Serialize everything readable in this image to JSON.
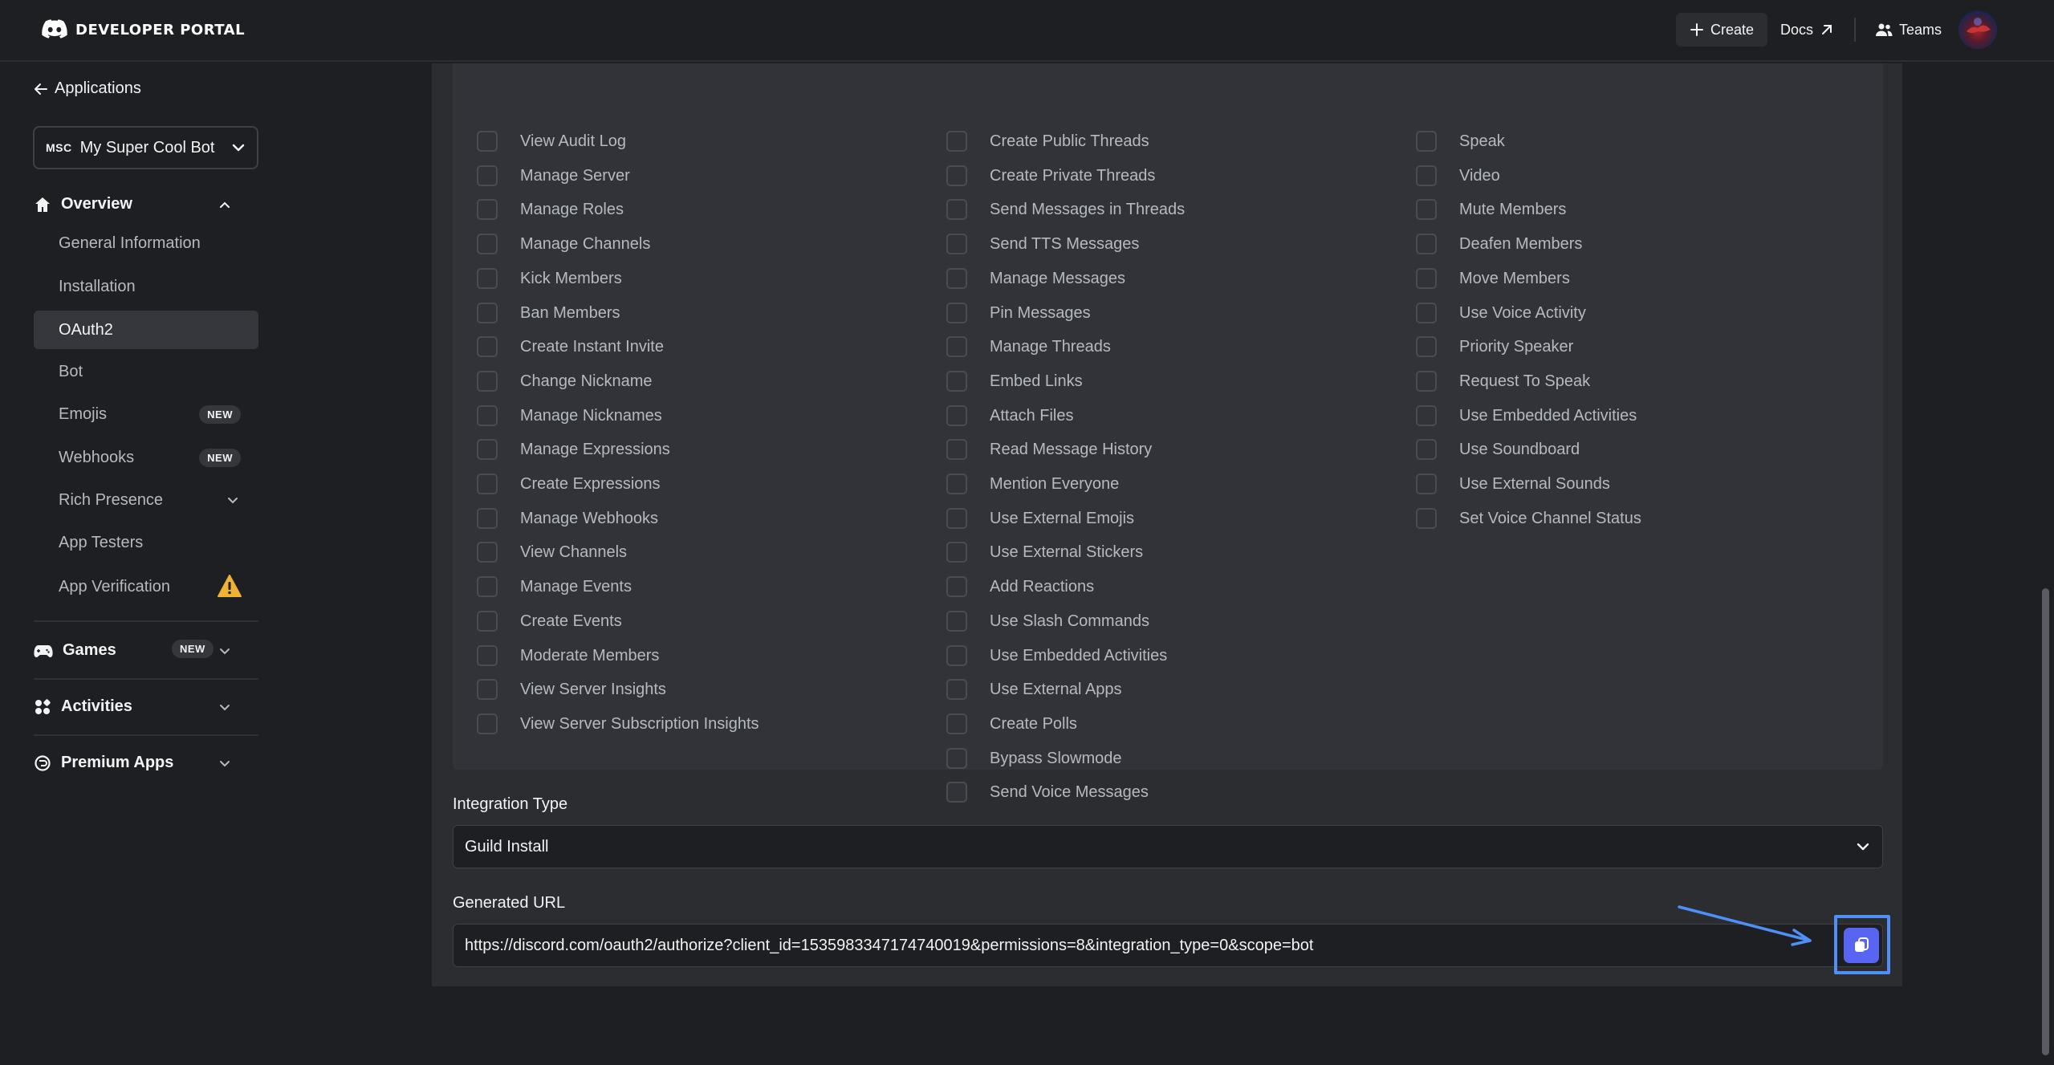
{
  "topbar": {
    "brand": "DEVELOPER PORTAL",
    "create_label": "Create",
    "docs_label": "Docs",
    "teams_label": "Teams"
  },
  "sidebar": {
    "back_label": "Applications",
    "app_selector": {
      "abbr": "MSC",
      "name": "My Super Cool Bot"
    },
    "overview_label": "Overview",
    "overview_items": [
      {
        "label": "General Information"
      },
      {
        "label": "Installation"
      },
      {
        "label": "OAuth2",
        "active": true
      },
      {
        "label": "Bot"
      },
      {
        "label": "Emojis",
        "badge": "NEW"
      },
      {
        "label": "Webhooks",
        "badge": "NEW"
      },
      {
        "label": "Rich Presence"
      },
      {
        "label": "App Testers"
      },
      {
        "label": "App Verification"
      }
    ],
    "sections": [
      {
        "label": "Games",
        "badge": "NEW"
      },
      {
        "label": "Activities"
      },
      {
        "label": "Premium Apps"
      }
    ]
  },
  "permissions": {
    "col1": [
      "View Audit Log",
      "Manage Server",
      "Manage Roles",
      "Manage Channels",
      "Kick Members",
      "Ban Members",
      "Create Instant Invite",
      "Change Nickname",
      "Manage Nicknames",
      "Manage Expressions",
      "Create Expressions",
      "Manage Webhooks",
      "View Channels",
      "Manage Events",
      "Create Events",
      "Moderate Members",
      "View Server Insights",
      "View Server Subscription Insights"
    ],
    "col2": [
      "Create Public Threads",
      "Create Private Threads",
      "Send Messages in Threads",
      "Send TTS Messages",
      "Manage Messages",
      "Pin Messages",
      "Manage Threads",
      "Embed Links",
      "Attach Files",
      "Read Message History",
      "Mention Everyone",
      "Use External Emojis",
      "Use External Stickers",
      "Add Reactions",
      "Use Slash Commands",
      "Use Embedded Activities",
      "Use External Apps",
      "Create Polls",
      "Bypass Slowmode",
      "Send Voice Messages"
    ],
    "col3": [
      "Speak",
      "Video",
      "Mute Members",
      "Deafen Members",
      "Move Members",
      "Use Voice Activity",
      "Priority Speaker",
      "Request To Speak",
      "Use Embedded Activities",
      "Use Soundboard",
      "Use External Sounds",
      "Set Voice Channel Status"
    ]
  },
  "integration": {
    "label": "Integration Type",
    "value": "Guild Install"
  },
  "generated_url": {
    "label": "Generated URL",
    "value": "https://discord.com/oauth2/authorize?client_id=1535983347174740019&permissions=8&integration_type=0&scope=bot"
  },
  "colors": {
    "accent": "#5865f2",
    "annotation": "#4f8ff7",
    "warning": "#f0b232"
  }
}
